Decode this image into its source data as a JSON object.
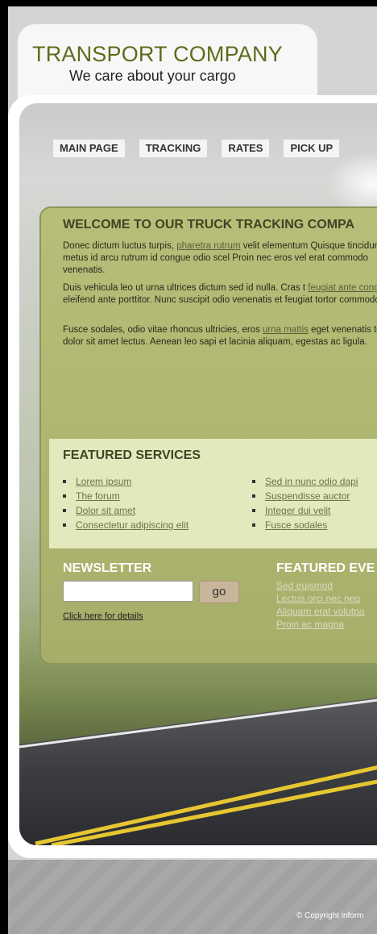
{
  "header": {
    "title": "TRANSPORT COMPANY",
    "tagline": "We care about your cargo"
  },
  "nav": {
    "items": [
      "MAIN PAGE",
      "TRACKING",
      "RATES",
      "PICK UP"
    ]
  },
  "welcome": {
    "title": "WELCOME TO OUR TRUCK TRACKING COMPA",
    "p1_pre": "Donec dictum luctus turpis, ",
    "p1_link": "pharetra rutrum",
    "p1_post": " velit elementum Quisque tincidunt metus id arcu rutrum id congue odio scel Proin nec eros vel erat commodo venenatis.",
    "p2_pre": "Duis vehicula leo ut urna ultrices dictum sed id nulla. Cras t ",
    "p2_link": "feugiat ante congue",
    "p2_post": " id eleifend ante porttitor. Nunc suscipit odio venenatis et feugiat tortor commodo.",
    "p3_pre": "Fusce sodales, odio vitae rhoncus ultricies, eros ",
    "p3_link": "urna mattis",
    "p3_post": " eget venenatis tellus dolor sit amet lectus. Aenean leo sapi et lacinia aliquam, egestas ac ligula."
  },
  "featured_services": {
    "title": "FEATURED SERVICES",
    "col1": [
      "Lorem ipsum",
      "The forum",
      "Dolor sit amet",
      "Consectetur adipiscing elit"
    ],
    "col2": [
      "Sed in nunc odio dapi",
      "Suspendisse auctor",
      "Integer dui velit",
      "Fusce sodales"
    ]
  },
  "newsletter": {
    "title": "NEWSLETTER",
    "input_value": "",
    "go_label": "go",
    "details_link": "Click here for details"
  },
  "featured_events": {
    "title": "FEATURED EVE",
    "items": [
      "Sed euismod",
      "Lectus orci nec neq",
      "Aliquam erat volutpa",
      "Proin ac magna"
    ]
  },
  "footer": {
    "copyright": "© Copyright inform"
  },
  "colors": {
    "brand_title": "#5f6b1c",
    "panel": "#a6ae6a",
    "featured_bg": "#e3e8bd"
  }
}
